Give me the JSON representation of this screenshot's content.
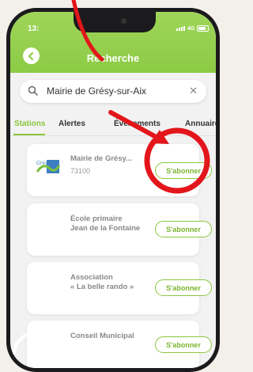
{
  "status": {
    "time": "13:",
    "network": "4G"
  },
  "header": {
    "title": "Recherche"
  },
  "search": {
    "value": "Mairie de Grésy-sur-Aix"
  },
  "tabs": [
    "Stations",
    "Alertes",
    "Événements",
    "Annuaire"
  ],
  "results": [
    {
      "name": "Mairie de Grésy...",
      "subtitle": "73100",
      "button": "S'abonner"
    },
    {
      "name_line1": "École primaire",
      "name_line2": "Jean de la Fontaine",
      "button": "S'abonner"
    },
    {
      "name_line1": "Association",
      "name_line2": "« La belle rando »",
      "button": "S'abonner"
    },
    {
      "name": "Conseil Municipal",
      "button": "S'abonner"
    }
  ],
  "colors": {
    "accent": "#8cc63f",
    "highlight": "#e2161b"
  }
}
